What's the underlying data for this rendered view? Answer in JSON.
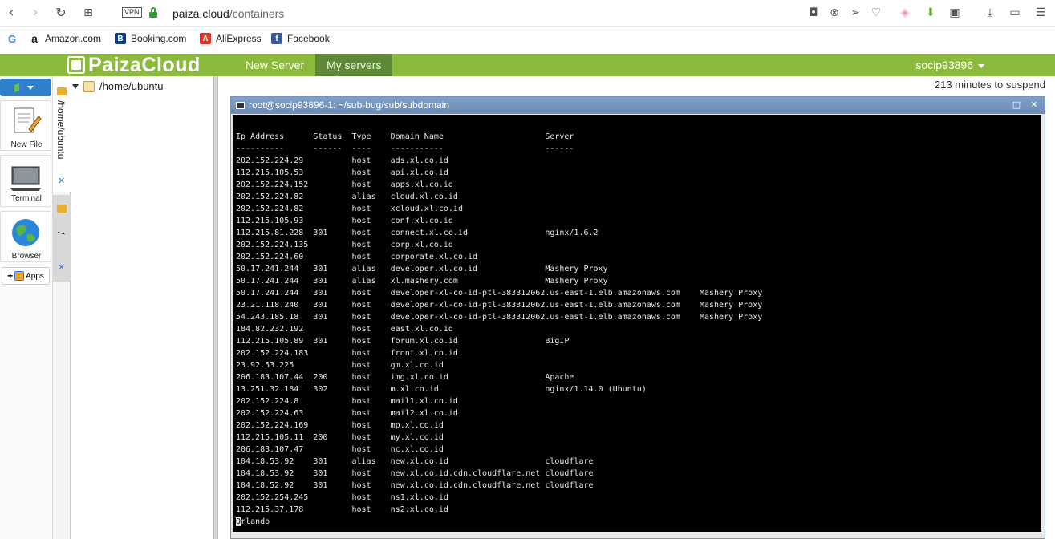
{
  "browser": {
    "vpn_label": "VPN",
    "url_host": "paiza.cloud",
    "url_path": "/containers"
  },
  "bookmarks": [
    {
      "label": "",
      "icon": "google-icon",
      "color": "#4285f4",
      "glyph": "G"
    },
    {
      "label": "Amazon.com",
      "icon": "amazon-icon",
      "color": "#222222",
      "glyph": "a"
    },
    {
      "label": "Booking.com",
      "icon": "booking-icon",
      "color": "#0c3b7c",
      "glyph": "B"
    },
    {
      "label": "AliExpress",
      "icon": "aliexpress-icon",
      "color": "#e43225",
      "glyph": "A"
    },
    {
      "label": "Facebook",
      "icon": "facebook-icon",
      "color": "#3b5998",
      "glyph": "f"
    }
  ],
  "header": {
    "logo_text": "PaizaCloud",
    "nav": [
      {
        "label": "New Server",
        "active": false
      },
      {
        "label": "My servers",
        "active": true
      }
    ],
    "user": "socip93896",
    "accent_color": "#8cba3c"
  },
  "sidebar": {
    "tiles": [
      {
        "label": "New File",
        "icon": "new-file-icon"
      },
      {
        "label": "Terminal",
        "icon": "terminal-icon"
      },
      {
        "label": "Browser",
        "icon": "browser-icon"
      }
    ],
    "apps_label": "Apps"
  },
  "vtabs": [
    {
      "label": "/home/ubuntu"
    },
    {
      "label": "/"
    }
  ],
  "filetree": {
    "root": "/home/ubuntu"
  },
  "workspace": {
    "suspend_text": "213 minutes to suspend"
  },
  "terminal": {
    "title": "root@socip93896-1: ~/sub-bug/sub/subdomain",
    "lines": [
      "Ip Address      Status  Type    Domain Name                     Server",
      "----------      ------  ----    -----------                     ------",
      "202.152.224.29          host    ads.xl.co.id",
      "112.215.105.53          host    api.xl.co.id",
      "202.152.224.152         host    apps.xl.co.id",
      "202.152.224.82          alias   cloud.xl.co.id",
      "202.152.224.82          host    xcloud.xl.co.id",
      "112.215.105.93          host    conf.xl.co.id",
      "112.215.81.228  301     host    connect.xl.co.id                nginx/1.6.2",
      "202.152.224.135         host    corp.xl.co.id",
      "202.152.224.60          host    corporate.xl.co.id",
      "50.17.241.244   301     alias   developer.xl.co.id              Mashery Proxy",
      "50.17.241.244   301     alias   xl.mashery.com                  Mashery Proxy",
      "50.17.241.244   301     host    developer-xl-co-id-ptl-383312062.us-east-1.elb.amazonaws.com    Mashery Proxy",
      "23.21.118.240   301     host    developer-xl-co-id-ptl-383312062.us-east-1.elb.amazonaws.com    Mashery Proxy",
      "54.243.185.18   301     host    developer-xl-co-id-ptl-383312062.us-east-1.elb.amazonaws.com    Mashery Proxy",
      "184.82.232.192          host    east.xl.co.id",
      "112.215.105.89  301     host    forum.xl.co.id                  BigIP",
      "202.152.224.183         host    front.xl.co.id",
      "23.92.53.225            host    gm.xl.co.id",
      "206.183.107.44  200     host    img.xl.co.id                    Apache",
      "13.251.32.184   302     host    m.xl.co.id                      nginx/1.14.0 (Ubuntu)",
      "202.152.224.8           host    mail1.xl.co.id",
      "202.152.224.63          host    mail2.xl.co.id",
      "202.152.224.169         host    mp.xl.co.id",
      "112.215.105.11  200     host    my.xl.co.id",
      "206.183.107.47          host    nc.xl.co.id",
      "104.18.53.92    301     alias   new.xl.co.id                    cloudflare",
      "104.18.53.92    301     host    new.xl.co.id.cdn.cloudflare.net cloudflare",
      "104.18.52.92    301     host    new.xl.co.id.cdn.cloudflare.net cloudflare",
      "202.152.254.245         host    ns1.xl.co.id",
      "112.215.37.178          host    ns2.xl.co.id"
    ],
    "cursor_char": "O",
    "prompt_rest": "rlando"
  }
}
